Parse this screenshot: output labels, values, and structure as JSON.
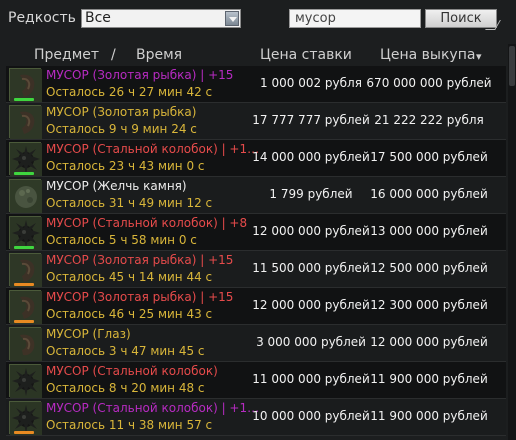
{
  "filter": {
    "rarity_label": "Редкость",
    "rarity_value": "Все",
    "search_value": "мусор",
    "search_button": "Поиск"
  },
  "header": {
    "item": "Предмет",
    "sep": "/",
    "time": "Время",
    "bid": "Цена ставки",
    "buy": "Цена выкупа",
    "sort_indicator": "▾"
  },
  "colors": {
    "purple": "#b72bc2",
    "gold": "#d9b63a",
    "red": "#e64b4b",
    "white": "#ececec",
    "bar_green": "#3fd63f",
    "bar_orange": "#e88a22"
  },
  "rows": [
    {
      "name": "МУСОР (Золотая рыбка) | +15",
      "name_color": "#b72bc2",
      "left": "Осталось 26 ч 27 мин 42 с",
      "bid": "1 000 002 рубля",
      "buy": "670 000 000 рублей",
      "icon": "goldfish-icon",
      "bar": "green"
    },
    {
      "name": "МУСОР (Золотая рыбка)",
      "name_color": "#d9b63a",
      "left": "Осталось 9 ч 9 мин 24 с",
      "bid": "17 777 777 рублей",
      "buy": "21 222 222 рубля",
      "icon": "goldfish-icon",
      "bar": ""
    },
    {
      "name": "МУСОР (Стальной колобок) | +1…",
      "name_color": "#e64b4b",
      "left": "Осталось 23 ч 43 мин 0 с",
      "bid": "14 000 000 рублей",
      "buy": "17 500 000 рублей",
      "icon": "steel-ball-icon",
      "bar": "green"
    },
    {
      "name": "МУСОР (Желчь камня)",
      "name_color": "#ececec",
      "left": "Осталось 31 ч 49 мин 12 с",
      "bid": "1 799 рублей",
      "buy": "16 000 000 рублей",
      "icon": "stone-bile-icon",
      "bar": ""
    },
    {
      "name": "МУСОР (Стальной колобок) | +8",
      "name_color": "#e64b4b",
      "left": "Осталось 5 ч 58 мин 0 с",
      "bid": "12 000 000 рублей",
      "buy": "13 000 000 рублей",
      "icon": "steel-ball-icon",
      "bar": "green"
    },
    {
      "name": "МУСОР (Золотая рыбка) | +15",
      "name_color": "#e64b4b",
      "left": "Осталось 45 ч 14 мин 44 с",
      "bid": "11 500 000 рублей",
      "buy": "12 500 000 рублей",
      "icon": "goldfish-icon",
      "bar": "orange"
    },
    {
      "name": "МУСОР (Золотая рыбка) | +15",
      "name_color": "#e64b4b",
      "left": "Осталось 46 ч 25 мин 43 с",
      "bid": "12 000 000 рублей",
      "buy": "12 300 000 рублей",
      "icon": "goldfish-icon",
      "bar": "orange"
    },
    {
      "name": "МУСОР (Глаз)",
      "name_color": "#d9b63a",
      "left": "Осталось 3 ч 47 мин 45 с",
      "bid": "3 000 000 рублей",
      "buy": "12 000 000 рублей",
      "icon": "eye-icon",
      "bar": ""
    },
    {
      "name": "МУСОР (Стальной колобок)",
      "name_color": "#e64b4b",
      "left": "Осталось 8 ч 20 мин 48 с",
      "bid": "11 000 000 рублей",
      "buy": "11 900 000 рублей",
      "icon": "steel-ball-icon",
      "bar": ""
    },
    {
      "name": "МУСОР (Стальной колобок) | +1…",
      "name_color": "#b72bc2",
      "left": "Осталось 11 ч 38 мин 57 с",
      "bid": "10 000 000 рублей",
      "buy": "11 900 000 рублей",
      "icon": "steel-ball-icon",
      "bar": "orange"
    }
  ]
}
